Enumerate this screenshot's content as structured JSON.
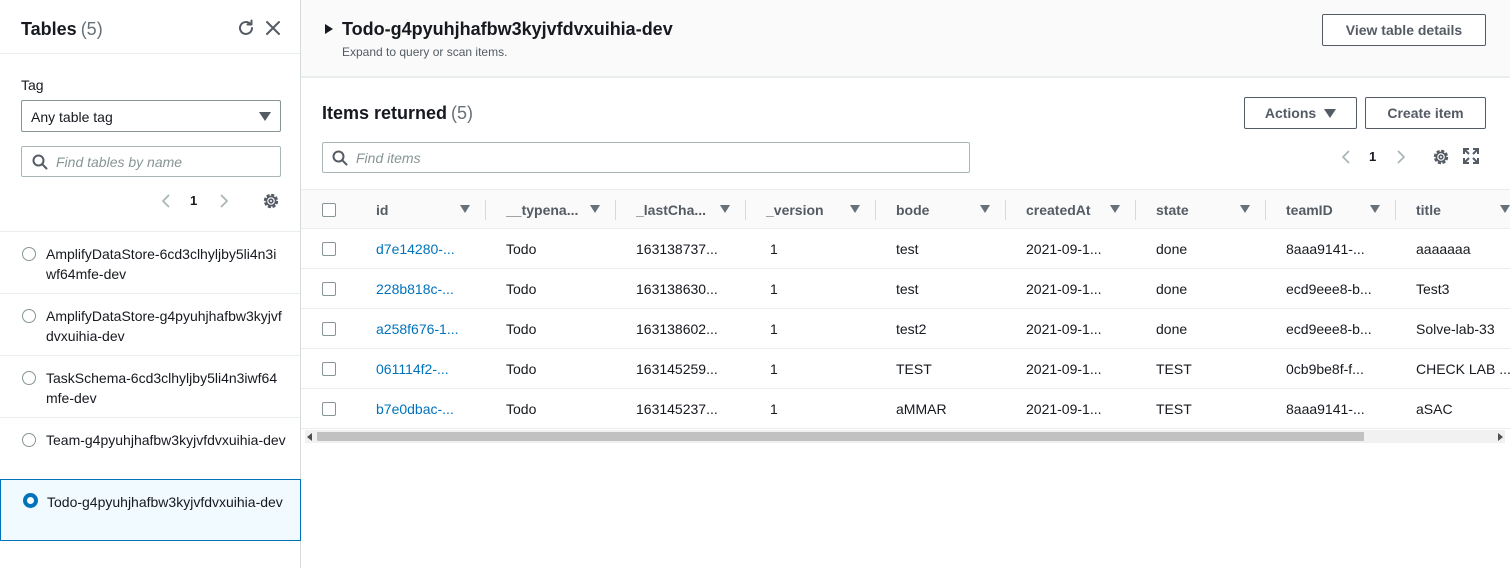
{
  "sidebar": {
    "title": "Tables",
    "count": "(5)",
    "refresh_icon": "refresh-icon",
    "close_icon": "close-icon",
    "tag_label": "Tag",
    "tag_select_value": "Any table tag",
    "search_placeholder": "Find tables by name",
    "page": "1",
    "tables": [
      {
        "name": "AmplifyDataStore-6cd3clhyljby5li4n3iwf64mfe-dev",
        "selected": false
      },
      {
        "name": "AmplifyDataStore-g4pyuhjhafbw3kyjvfdvxuihia-dev",
        "selected": false
      },
      {
        "name": "TaskSchema-6cd3clhyljby5li4n3iwf64mfe-dev",
        "selected": false
      },
      {
        "name": "Team-g4pyuhjhafbw3kyjvfdvxuihia-dev",
        "selected": false
      },
      {
        "name": "Todo-g4pyuhjhafbw3kyjvfdvxuihia-dev",
        "selected": true
      }
    ]
  },
  "main": {
    "table_title": "Todo-g4pyuhjhafbw3kyjvfdvxuihia-dev",
    "table_subtitle": "Expand to query or scan items.",
    "view_details_label": "View table details",
    "items_title": "Items returned",
    "items_count": "(5)",
    "actions_label": "Actions",
    "create_item_label": "Create item",
    "items_search_placeholder": "Find items",
    "page": "1",
    "columns": [
      "id",
      "__typena...",
      "_lastCha...",
      "_version",
      "bode",
      "createdAt",
      "state",
      "teamID",
      "title"
    ],
    "rows": [
      [
        "d7e14280-...",
        "Todo",
        "163138737...",
        "1",
        "test",
        "2021-09-1...",
        "done",
        "8aaa9141-...",
        "aaaaaaa"
      ],
      [
        "228b818c-...",
        "Todo",
        "163138630...",
        "1",
        "test",
        "2021-09-1...",
        "done",
        "ecd9eee8-b...",
        "Test3"
      ],
      [
        "a258f676-1...",
        "Todo",
        "163138602...",
        "1",
        "test2",
        "2021-09-1...",
        "done",
        "ecd9eee8-b...",
        "Solve-lab-33"
      ],
      [
        "061114f2-...",
        "Todo",
        "163145259...",
        "1",
        "TEST",
        "2021-09-1...",
        "TEST",
        "0cb9be8f-f...",
        "CHECK LAB ..."
      ],
      [
        "b7e0dbac-...",
        "Todo",
        "163145237...",
        "1",
        "aMMAR",
        "2021-09-1...",
        "TEST",
        "8aaa9141-...",
        "aSAC"
      ]
    ]
  },
  "colors": {
    "accent": "#0073bb",
    "text": "#16191f",
    "muted": "#545b64",
    "border": "#eaeded"
  }
}
